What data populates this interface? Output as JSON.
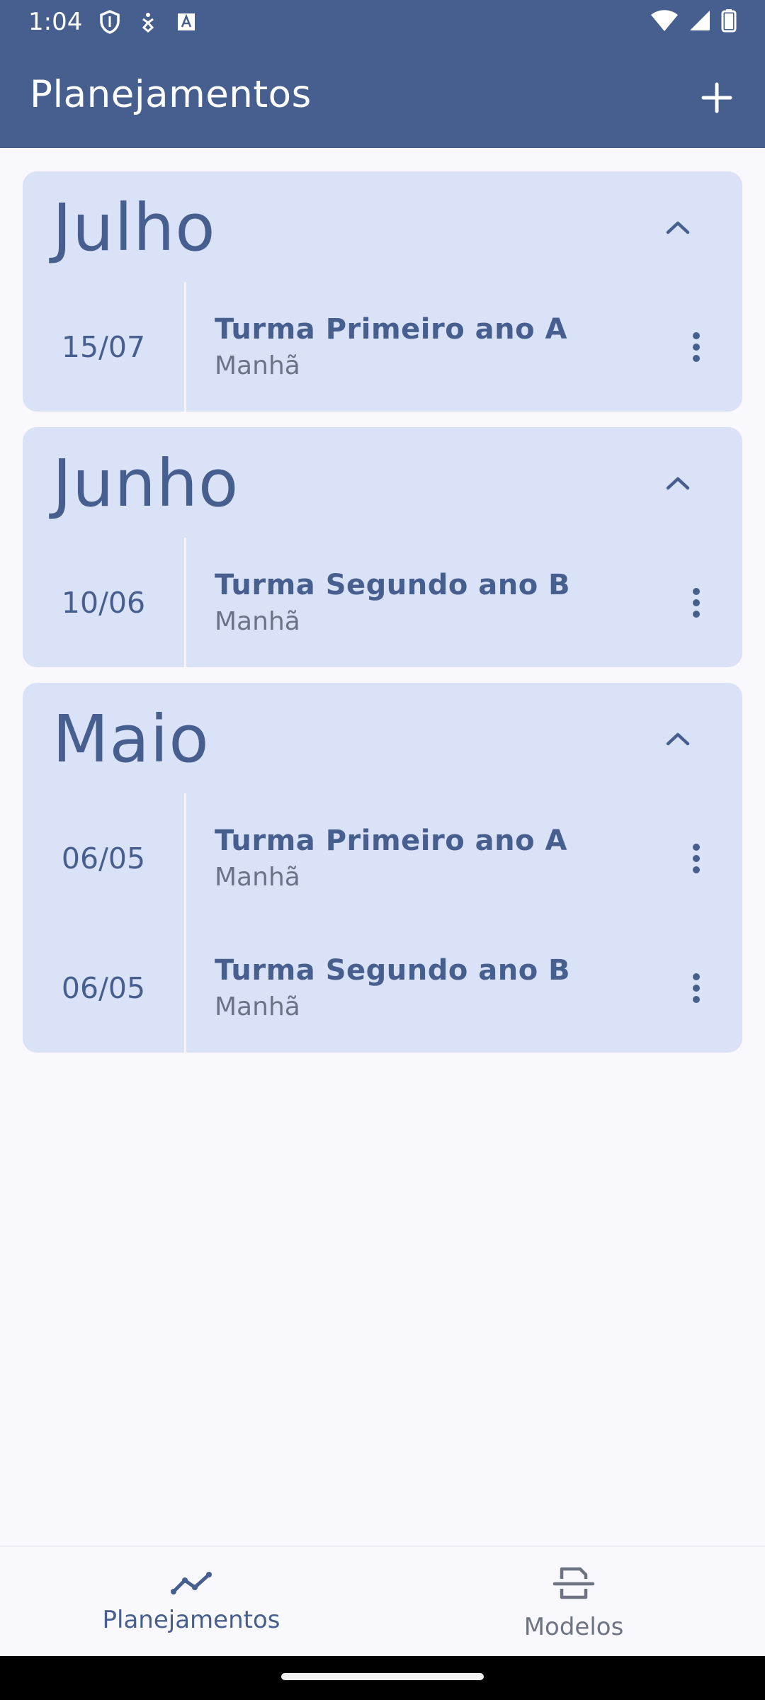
{
  "status_bar": {
    "time": "1:04"
  },
  "app_bar": {
    "title": "Planejamentos"
  },
  "groups": [
    {
      "month": "Julho",
      "entries": [
        {
          "date": "15/07",
          "title": "Turma Primeiro ano A",
          "shift": "Manhã"
        }
      ]
    },
    {
      "month": "Junho",
      "entries": [
        {
          "date": "10/06",
          "title": "Turma Segundo ano B",
          "shift": "Manhã"
        }
      ]
    },
    {
      "month": "Maio",
      "entries": [
        {
          "date": "06/05",
          "title": "Turma Primeiro ano A",
          "shift": "Manhã"
        },
        {
          "date": "06/05",
          "title": "Turma Segundo ano B",
          "shift": "Manhã"
        }
      ]
    }
  ],
  "bottom_nav": {
    "items": [
      {
        "label": "Planejamentos",
        "icon": "trend-line-icon",
        "active": true
      },
      {
        "label": "Modelos",
        "icon": "document-scan-icon",
        "active": false
      }
    ]
  },
  "colors": {
    "primary": "#475f8f",
    "card": "#dae2f7",
    "background": "#f8f8fd"
  }
}
